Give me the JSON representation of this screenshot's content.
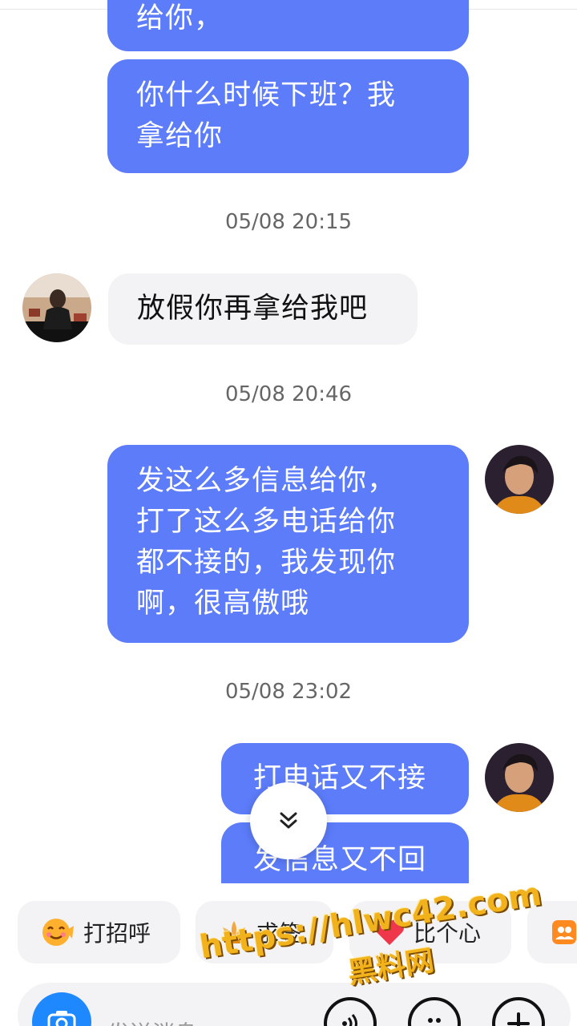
{
  "messages": {
    "m1_partial": "给你，",
    "m2": [
      "你什么时候下班？我",
      "拿给你"
    ],
    "ts1": "05/08 20:15",
    "m3": "放假你再拿给我吧",
    "ts2": "05/08 20:46",
    "m4": [
      "发这么多信息给你，",
      "打了这么多电话给你",
      "都不接的，我发现你",
      "啊，很高傲哦"
    ],
    "ts3": "05/08 23:02",
    "m5": "打电话又不接",
    "m6": "发信息又不回"
  },
  "quick_replies": [
    {
      "label": "打招呼",
      "icon": "smile-emoji-icon"
    },
    {
      "label": "求签",
      "icon": "lotus-icon"
    },
    {
      "label": "比个心",
      "icon": "heart-icon"
    },
    {
      "label": "",
      "icon": "group-icon"
    }
  ],
  "input": {
    "placeholder": "发送消息"
  },
  "watermark": {
    "url": "https://hlwc42.com",
    "name": "黑料网"
  },
  "colors": {
    "outgoing_bubble": "#5c7cfa",
    "incoming_bubble": "#f3f3f5",
    "accent": "#1e88ff"
  }
}
